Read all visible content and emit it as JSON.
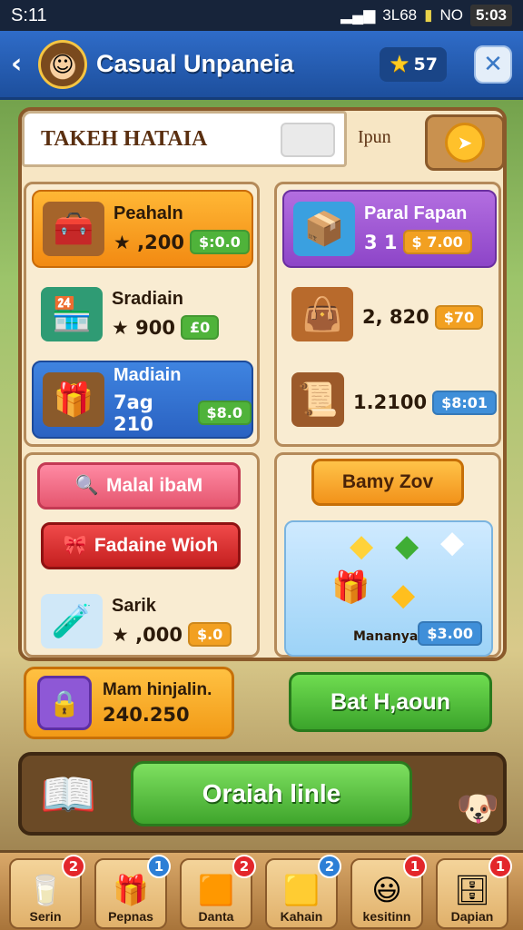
{
  "status_bar": {
    "time_left": "S:11",
    "signal_text": "3L68",
    "indicator": "NO",
    "clock": "5:03"
  },
  "header": {
    "title": "Casual Unpaneia",
    "stars": "57"
  },
  "panel": {
    "search_label": "TAKEH HATAIA",
    "tab_label": "Ipun"
  },
  "left_column": [
    {
      "name": "Peahaln",
      "value": "★ ,200",
      "price": "$:0.0"
    },
    {
      "name": "Sradiain",
      "value": "★ 900",
      "price": "£0"
    },
    {
      "name": "Madiain",
      "value": "7ag 210",
      "price": "$8.0"
    }
  ],
  "right_column": [
    {
      "name": "Paral Fapan",
      "value": "3 1",
      "price": "$ 7.00"
    },
    {
      "name": "",
      "value": "2, 820",
      "price": "$70"
    },
    {
      "name": "",
      "value": "1.2100",
      "price": "$8:01"
    }
  ],
  "left_section2": {
    "btn1": "Malal ibaM",
    "btn2": "Fadaine Wioh",
    "item_name": "Sarik",
    "item_value": "★ ,000",
    "item_price": "$.0"
  },
  "right_section2": {
    "btn": "Bamy Zov",
    "gems_label": "Mananyara",
    "gems_price": "$3.00"
  },
  "promo": {
    "name": "Mam hinjalin.",
    "value": "240.250"
  },
  "green_button": "Bat H,aoun",
  "action_bar": {
    "main_button": "Oraiah linle"
  },
  "bottom_nav": [
    {
      "label": "Serin",
      "badge": "2",
      "badge_color": "red"
    },
    {
      "label": "Pepnas",
      "badge": "1",
      "badge_color": "blue"
    },
    {
      "label": "Danta",
      "badge": "2",
      "badge_color": "red"
    },
    {
      "label": "Kahain",
      "badge": "2",
      "badge_color": "blue"
    },
    {
      "label": "kesitinn",
      "badge": "1",
      "badge_color": "red"
    },
    {
      "label": "Dapian",
      "badge": "1",
      "badge_color": "red"
    }
  ],
  "colors": {
    "header": "#2f6cc8",
    "panel": "#f7e6c4",
    "accent_green": "#3fa52c",
    "accent_orange": "#f29a16"
  }
}
